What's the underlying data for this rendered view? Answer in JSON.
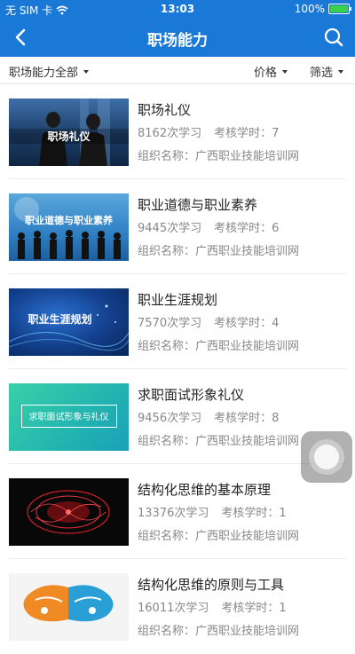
{
  "status_bar": {
    "carrier": "无 SIM 卡",
    "time": "13:03",
    "battery": "100%",
    "battery_color": "#39d04a"
  },
  "nav": {
    "title": "职场能力",
    "back_icon": "chevron-left-icon",
    "search_icon": "search-icon",
    "color": "#1a78d6"
  },
  "filters": {
    "category": "职场能力全部",
    "price": "价格",
    "filter": "筛选"
  },
  "courses": [
    {
      "title": "职场礼仪",
      "learners": "8162次学习",
      "hours": "考核学时：7",
      "org": "组织名称：广西职业技能培训网",
      "thumb_caption": "职场礼仪"
    },
    {
      "title": "职业道德与职业素养",
      "learners": "9445次学习",
      "hours": "考核学时：6",
      "org": "组织名称：广西职业技能培训网",
      "thumb_caption": "职业道德与职业素养"
    },
    {
      "title": "职业生涯规划",
      "learners": "7570次学习",
      "hours": "考核学时：4",
      "org": "组织名称：广西职业技能培训网",
      "thumb_caption": "职业生涯规划"
    },
    {
      "title": "求职面试形象礼仪",
      "learners": "9456次学习",
      "hours": "考核学时：8",
      "org": "组织名称：广西职业技能培训网",
      "thumb_caption": "求职面试形象与礼仪"
    },
    {
      "title": "结构化思维的基本原理",
      "learners": "13376次学习",
      "hours": "考核学时：1",
      "org": "组织名称：广西职业技能培训网",
      "thumb_caption": ""
    },
    {
      "title": "结构化思维的原则与工具",
      "learners": "16011次学习",
      "hours": "考核学时：1",
      "org": "组织名称：广西职业技能培训网",
      "thumb_caption": ""
    }
  ]
}
